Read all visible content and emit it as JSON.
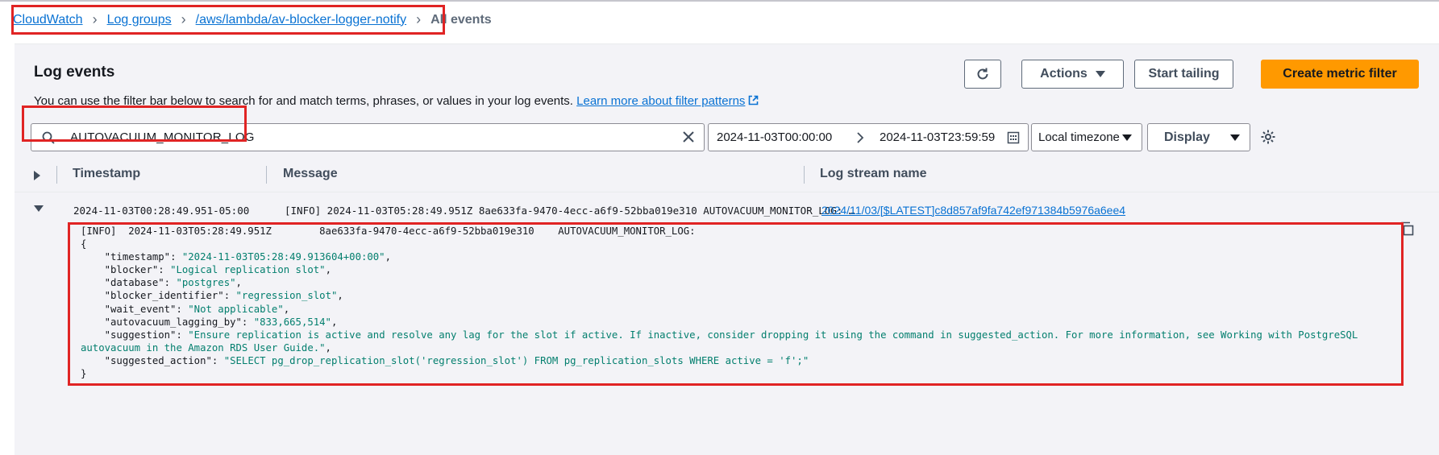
{
  "breadcrumb": {
    "items": [
      "CloudWatch",
      "Log groups",
      "/aws/lambda/av-blocker-logger-notify"
    ],
    "current": "All events"
  },
  "panel": {
    "title": "Log events",
    "description": "You can use the filter bar below to search for and match terms, phrases, or values in your log events.",
    "learn_more": "Learn more about filter patterns"
  },
  "toolbar": {
    "actions_label": "Actions",
    "start_tailing_label": "Start tailing",
    "create_metric_filter_label": "Create metric filter"
  },
  "filter": {
    "search_value": "AUTOVACUUM_MONITOR_LOG",
    "date_start": "2024-11-03T00:00:00",
    "date_end": "2024-11-03T23:59:59",
    "timezone": "Local timezone",
    "display_label": "Display"
  },
  "table": {
    "headers": [
      "Timestamp",
      "Message",
      "Log stream name"
    ],
    "row": {
      "timestamp": "2024-11-03T00:28:49.951-05:00",
      "message": "[INFO] 2024-11-03T05:28:49.951Z 8ae633fa-9470-4ecc-a6f9-52bba019e310 AUTOVACUUM_MONITOR_LOG: …",
      "log_stream": "2024/11/03/[$LATEST]c8d857af9fa742ef971384b5976a6ee4"
    }
  },
  "expanded": {
    "header_line": "[INFO]  2024-11-03T05:28:49.951Z        8ae633fa-9470-4ecc-a6f9-52bba019e310    AUTOVACUUM_MONITOR_LOG:",
    "open_brace": "{",
    "close_brace": "}",
    "fields": [
      {
        "key": "\"timestamp\"",
        "value": "\"2024-11-03T05:28:49.913604+00:00\""
      },
      {
        "key": "\"blocker\"",
        "value": "\"Logical replication slot\""
      },
      {
        "key": "\"database\"",
        "value": "\"postgres\""
      },
      {
        "key": "\"blocker_identifier\"",
        "value": "\"regression_slot\""
      },
      {
        "key": "\"wait_event\"",
        "value": "\"Not applicable\""
      },
      {
        "key": "\"autovacuum_lagging_by\"",
        "value": "\"833,665,514\""
      },
      {
        "key": "\"suggestion\"",
        "value": "\"Ensure replication is active and resolve any lag for the slot if active. If inactive, consider dropping it using the command in suggested_action. For more information, see Working with PostgreSQL"
      },
      {
        "key": "",
        "value": "autovacuum in the Amazon RDS User Guide.\""
      },
      {
        "key": "\"suggested_action\"",
        "value": "\"SELECT pg_drop_replication_slot('regression_slot') FROM pg_replication_slots WHERE active = 'f';\""
      }
    ]
  }
}
